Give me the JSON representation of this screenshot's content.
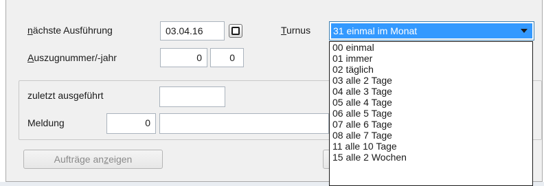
{
  "form": {
    "next_execution": {
      "prefix": "",
      "accel": "n",
      "rest": "ächste Ausführung",
      "value": "03.04.16"
    },
    "statement": {
      "prefix": "",
      "accel": "A",
      "rest": "uszugnummer/-jahr",
      "number": "0",
      "year": "0"
    },
    "interval": {
      "prefix": "",
      "accel": "T",
      "rest": "urnus",
      "selected": "31 einmal im Monat",
      "options": [
        "00 einmal",
        "01 immer",
        "02 täglich",
        "03 alle 2 Tage",
        "04 alle 3 Tage",
        "05 alle 4 Tage",
        "06 alle 5 Tage",
        "07 alle 6 Tage",
        "08 alle 7 Tage",
        "11 alle 10 Tage",
        "15 alle 2 Wochen"
      ]
    },
    "last_executed": {
      "label": "zuletzt ausgeführt",
      "value": ""
    },
    "message": {
      "label": "Meldung",
      "count": "0",
      "text": ""
    },
    "show_orders_button": {
      "prefix": "Aufträge an",
      "accel": "z",
      "rest": "eigen"
    }
  },
  "colors": {
    "selection": "#3399ff",
    "dialog_bg": "#f0f0f0",
    "disabled_text": "#8a8a8a"
  },
  "icons": {
    "calendar_button": "calendar-icon",
    "combo_arrow": "chevron-down-icon"
  }
}
